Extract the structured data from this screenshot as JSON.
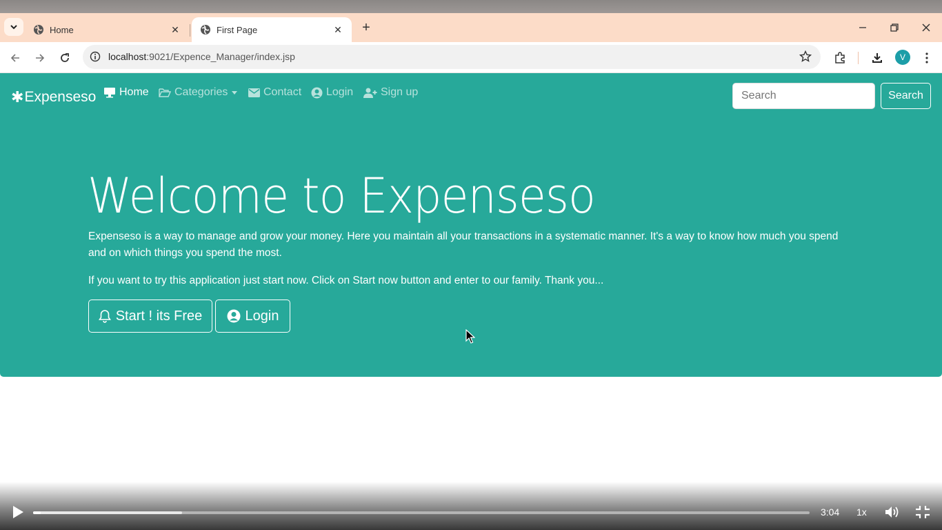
{
  "browser": {
    "tabs": [
      {
        "title": "Home",
        "active": false
      },
      {
        "title": "First Page",
        "active": true
      }
    ],
    "url_host": "localhost",
    "url_rest": ":9021/Expence_Manager/index.jsp",
    "profile_initial": "V"
  },
  "navbar": {
    "brand_symbol": "✱",
    "brand": "Expenseso",
    "items": [
      {
        "label": "Home",
        "icon": "monitor-icon",
        "active": true
      },
      {
        "label": "Categories",
        "icon": "folder-open-icon",
        "dropdown": true
      },
      {
        "label": "Contact",
        "icon": "envelope-icon"
      },
      {
        "label": "Login",
        "icon": "user-circle-icon"
      },
      {
        "label": "Sign up",
        "icon": "user-plus-icon"
      }
    ],
    "search_placeholder": "Search",
    "search_button": "Search"
  },
  "hero": {
    "title": "Welcome to Expenseso",
    "paragraph1": "Expenseso is a way to manage and grow your money. Here you maintain all your transactions in a systematic manner. It's a way to know how much you spend and on which things you spend the most.",
    "paragraph2": "If you want to try this application just start now. Click on Start now button and enter to our family. Thank you...",
    "start_button": "Start ! its Free",
    "login_button": "Login"
  },
  "video": {
    "time": "3:04",
    "speed": "1x",
    "played_fraction": 0.01,
    "buffered_fraction": 0.192
  },
  "colors": {
    "accent": "#27a99a",
    "tabbar": "#fcdcc8"
  }
}
